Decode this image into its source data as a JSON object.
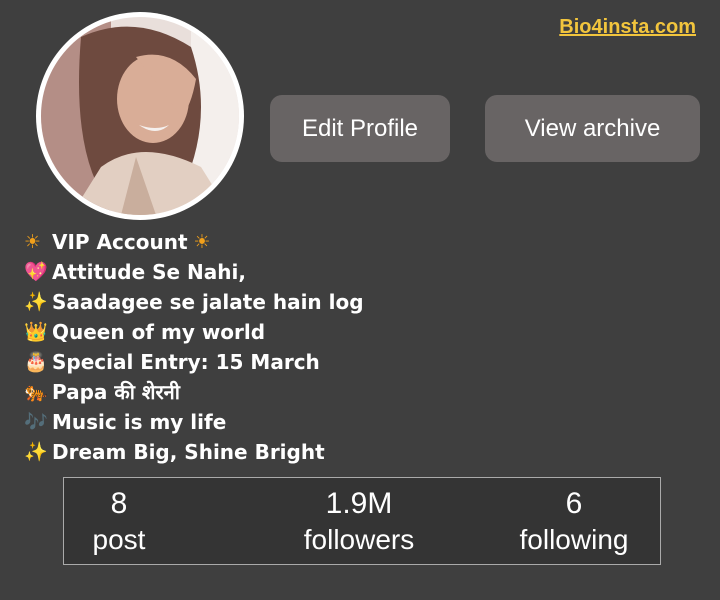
{
  "header": {
    "site_link": "Bio4insta.com"
  },
  "profile": {
    "edit_button": "Edit Profile",
    "archive_button": "View archive"
  },
  "bio": {
    "lines": [
      {
        "icon": "sun-icon",
        "glyph": "☀",
        "text": "VIP Account",
        "trail": "☀"
      },
      {
        "icon": "heart-icon",
        "glyph": "💖",
        "text": "Attitude Se Nahi,"
      },
      {
        "icon": "sparkles-icon",
        "glyph": "✨",
        "text": "Saadagee se jalate hain log"
      },
      {
        "icon": "crown-icon",
        "glyph": "👑",
        "text": "Queen of my world"
      },
      {
        "icon": "cake-icon",
        "glyph": "🎂",
        "text": "Special Entry: 15 March"
      },
      {
        "icon": "tiger-icon",
        "glyph": "🐅",
        "text": "Papa की शेरनी"
      },
      {
        "icon": "music-notes-icon",
        "glyph": "🎶",
        "text": "Music is my life"
      },
      {
        "icon": "sparkles-icon",
        "glyph": "✨",
        "text": "Dream Big, Shine Bright"
      }
    ]
  },
  "stats": {
    "posts": {
      "value": "8",
      "label": "post"
    },
    "followers": {
      "value": "1.9M",
      "label": "followers"
    },
    "following": {
      "value": "6",
      "label": "following"
    }
  },
  "colors": {
    "background": "#3f3f3f",
    "button": "#686464",
    "link": "#f2c53d",
    "stats_panel": "#343434"
  }
}
